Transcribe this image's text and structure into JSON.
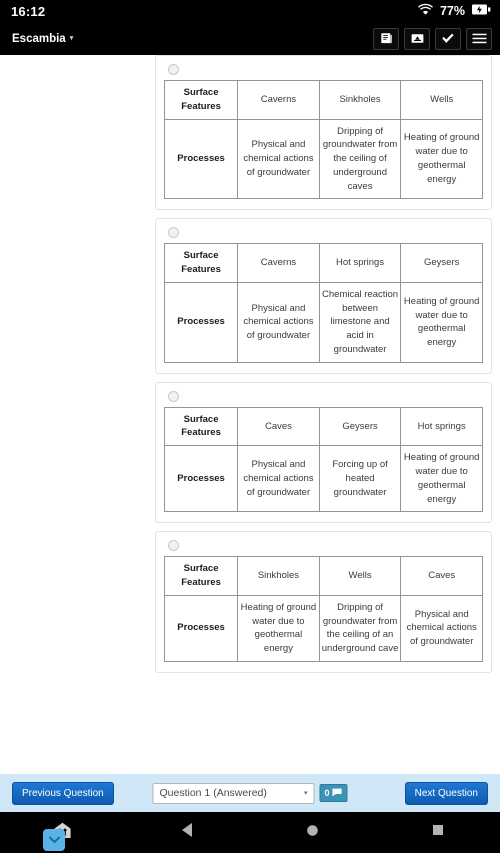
{
  "status_bar": {
    "clock": "16:12",
    "battery_percent": "77%",
    "wifi_icon": "wifi-icon",
    "battery_icon": "battery-charging-icon"
  },
  "header": {
    "district": "Escambia",
    "caret": "▾",
    "actions": [
      {
        "name": "notebook-icon",
        "label": "Notebook"
      },
      {
        "name": "inbox-icon",
        "label": "Inbox"
      },
      {
        "name": "check-icon",
        "label": "Check"
      },
      {
        "name": "hamburger-menu-icon",
        "label": "Menu"
      }
    ]
  },
  "question": {
    "row_labels": [
      "Surface Features",
      "Processes"
    ],
    "options": [
      {
        "selected": false,
        "features": [
          "Caverns",
          "Sinkholes",
          "Wells"
        ],
        "processes": [
          "Physical and chemical actions of groundwater",
          "Dripping of groundwater from the ceiling of underground caves",
          "Heating of ground water due to geothermal energy"
        ]
      },
      {
        "selected": false,
        "features": [
          "Caverns",
          "Hot springs",
          "Geysers"
        ],
        "processes": [
          "Physical and chemical actions of groundwater",
          "Chemical reaction between limestone and acid in groundwater",
          "Heating of ground water due to geothermal energy"
        ]
      },
      {
        "selected": false,
        "features": [
          "Caves",
          "Geysers",
          "Hot springs"
        ],
        "processes": [
          "Physical and chemical actions of groundwater",
          "Forcing up of heated groundwater",
          "Heating of ground water due to geothermal energy"
        ]
      },
      {
        "selected": false,
        "features": [
          "Sinkholes",
          "Wells",
          "Caves"
        ],
        "processes": [
          "Heating of ground water due to geothermal energy",
          "Dripping of groundwater from the ceiling of an underground cave",
          "Physical and chemical actions of groundwater"
        ]
      }
    ]
  },
  "qnav": {
    "previous_label": "Previous Question",
    "next_label": "Next Question",
    "selected_question": "Question 1 (Answered)",
    "caret": "▾",
    "flag_count": "0"
  },
  "nav_bar": {
    "items": [
      {
        "name": "keyguard-icon"
      },
      {
        "name": "back-icon"
      },
      {
        "name": "home-icon"
      },
      {
        "name": "recents-icon"
      }
    ]
  },
  "colors": {
    "accent_blue": "#1565c0",
    "nav_background": "#cfe7f7",
    "flag_badge": "#3b93b5",
    "fab": "#5ab2e6"
  }
}
